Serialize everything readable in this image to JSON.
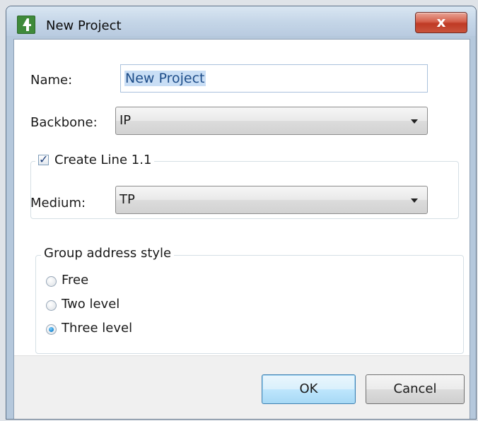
{
  "window": {
    "title": "New Project",
    "close_label": "x"
  },
  "form": {
    "name_label": "Name:",
    "name_value": "New Project",
    "backbone_label": "Backbone:",
    "backbone_value": "IP",
    "create_line_label": "Create Line 1.1",
    "create_line_checked": true,
    "medium_label": "Medium:",
    "medium_value": "TP",
    "group_address_style_label": "Group address style",
    "group_address_options": [
      {
        "label": "Free",
        "checked": false
      },
      {
        "label": "Two level",
        "checked": false
      },
      {
        "label": "Three level",
        "checked": true
      }
    ]
  },
  "buttons": {
    "ok_label": "OK",
    "cancel_label": "Cancel"
  },
  "icons": {
    "app_icon": "ets-app-icon",
    "close_icon": "close-icon",
    "dropdown_icon": "chevron-down-icon"
  },
  "colors": {
    "close_button": "#c9543d",
    "selection_highlight": "#c9def5",
    "radio_selected": "#1a86cf"
  }
}
